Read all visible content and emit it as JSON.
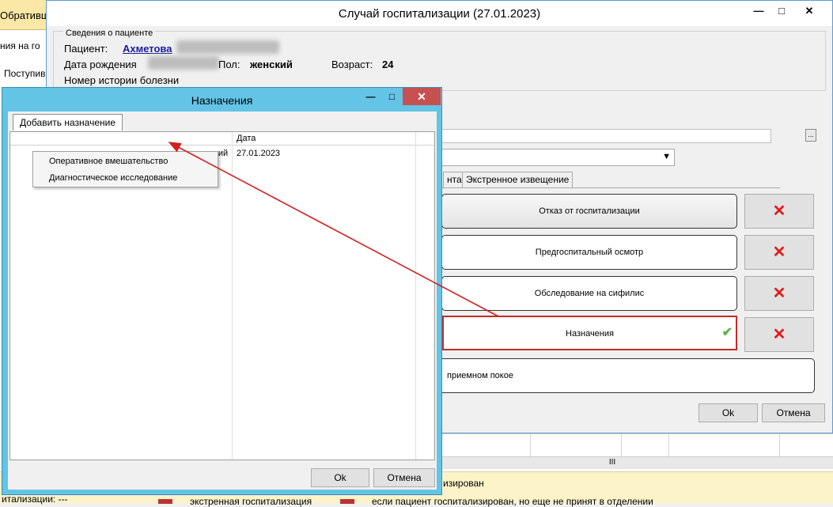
{
  "background": {
    "top_tab_text": "Обративш",
    "left_lines": [
      "ния на го",
      "Поступив"
    ],
    "bottom_left": "итализации: ---",
    "bottom_mid_1": "экстренная госпитализация",
    "bottom_mid_2": "изирован",
    "bottom_right": "если пациент госпитализирован, но еще не принят в отделении",
    "scroll_grip": "III"
  },
  "main_window": {
    "title": "Случай госпитализации (27.01.2023)",
    "patient_section": {
      "legend": "Сведения о пациенте",
      "patient_label": "Пациент:",
      "patient_name": "Ахметова",
      "birth_label": "Дата рождения",
      "sex_label": "Пол:",
      "sex_value": "женский",
      "age_label": "Возраст:",
      "age_value": "24",
      "history_label": "Номер истории болезни"
    },
    "ellipsis": "...",
    "tabs": [
      "нта",
      "Экстренное извещение"
    ],
    "actions": [
      {
        "label": "Отказ от госпитализации"
      },
      {
        "label": "Предгоспитальный осмотр"
      },
      {
        "label": "Обследование на сифилис"
      },
      {
        "label": "Назначения"
      },
      {
        "label": "приемном покое"
      }
    ],
    "ok_label": "Ok",
    "cancel_label": "Отмена"
  },
  "dialog": {
    "title": "Назначения",
    "menu_tab": "Добавить назначение",
    "dropdown": [
      "Оперативное вмешательство",
      "Диагностическое исследование"
    ],
    "grid": {
      "date_header": "Дата",
      "row_partial": "кий",
      "row_date": "27.01.2023"
    },
    "ok_label": "Ok",
    "cancel_label": "Отмена"
  },
  "colors": {
    "dialog_frame": "#63c4e6",
    "close_button": "#c75050",
    "highlight": "#c42b2b",
    "arrow": "#d21f1f",
    "delete_x": "#e01b1b",
    "check": "#5ab34a",
    "patient_link": "#1b1b9a"
  },
  "icons": {
    "delete": "red-x-icon",
    "done": "green-check-icon"
  }
}
